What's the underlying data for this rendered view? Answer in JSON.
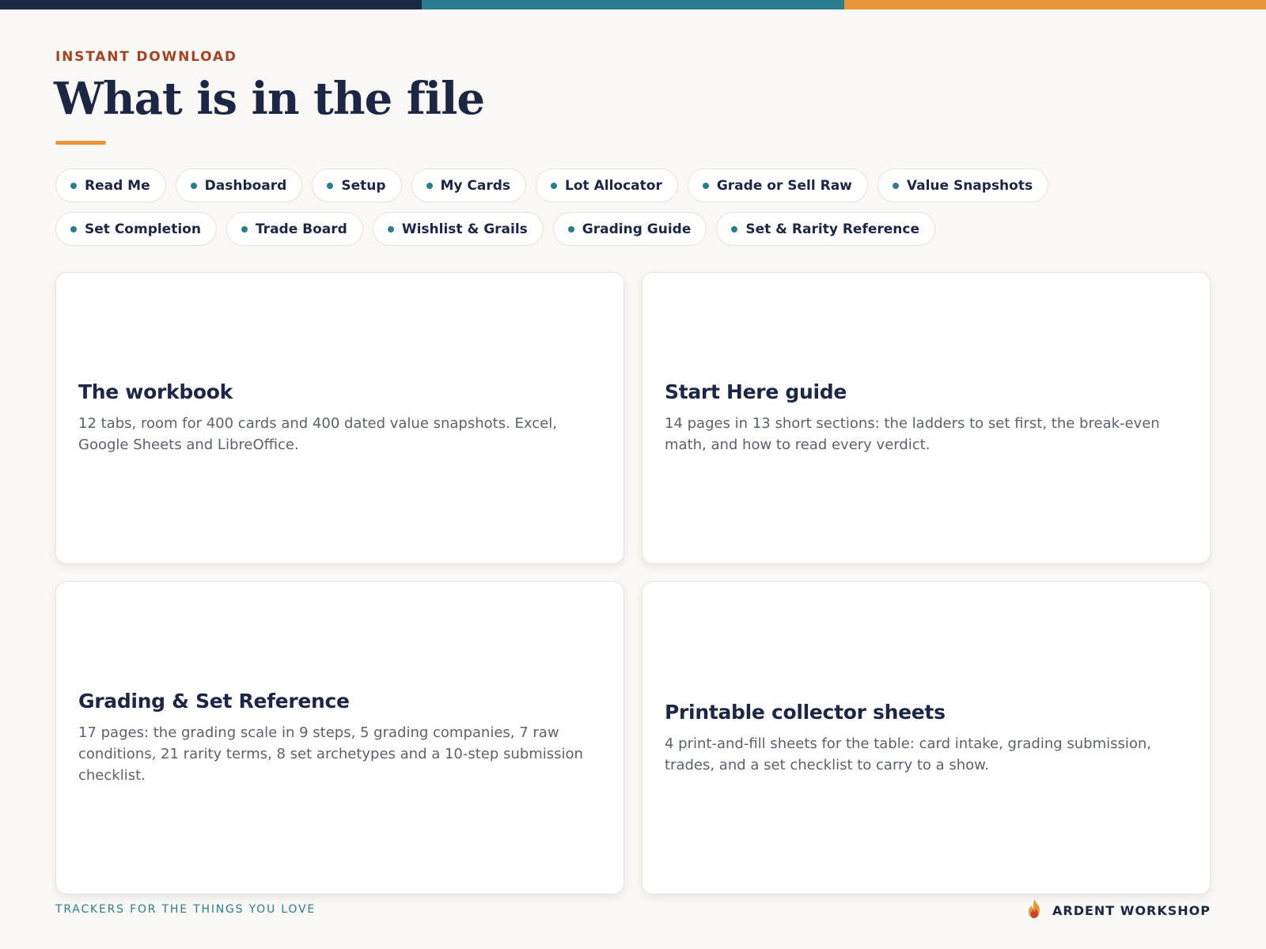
{
  "colors": {
    "navy": "#1c2745",
    "teal": "#2a7d8e",
    "orange": "#e9953a",
    "rust": "#a8421f",
    "background": "#f9f8f5"
  },
  "header": {
    "eyebrow": "INSTANT DOWNLOAD",
    "title": "What is in the file"
  },
  "tabs": [
    {
      "label": "Read Me"
    },
    {
      "label": "Dashboard"
    },
    {
      "label": "Setup"
    },
    {
      "label": "My Cards"
    },
    {
      "label": "Lot Allocator"
    },
    {
      "label": "Grade or Sell Raw"
    },
    {
      "label": "Value Snapshots"
    },
    {
      "label": "Set Completion"
    },
    {
      "label": "Trade Board"
    },
    {
      "label": "Wishlist & Grails"
    },
    {
      "label": "Grading Guide"
    },
    {
      "label": "Set & Rarity Reference"
    }
  ],
  "cards": [
    {
      "title": "The workbook",
      "body": "12 tabs, room for 400 cards and 400 dated value snapshots. Excel, Google Sheets and LibreOffice."
    },
    {
      "title": "Start Here guide",
      "body": "14 pages in 13 short sections: the ladders to set first, the break-even math, and how to read every verdict."
    },
    {
      "title": "Grading & Set Reference",
      "body": "17 pages: the grading scale in 9 steps, 5 grading companies, 7 raw conditions, 21 rarity terms, 8 set archetypes and a 10-step submission checklist."
    },
    {
      "title": "Printable collector sheets",
      "body": "4 print-and-fill sheets for the table: card intake, grading submission, trades, and a set checklist to carry to a show."
    }
  ],
  "footer": {
    "tagline": "TRACKERS FOR THE THINGS YOU LOVE",
    "brand": "ARDENT WORKSHOP",
    "brand_icon": "flame-icon"
  }
}
